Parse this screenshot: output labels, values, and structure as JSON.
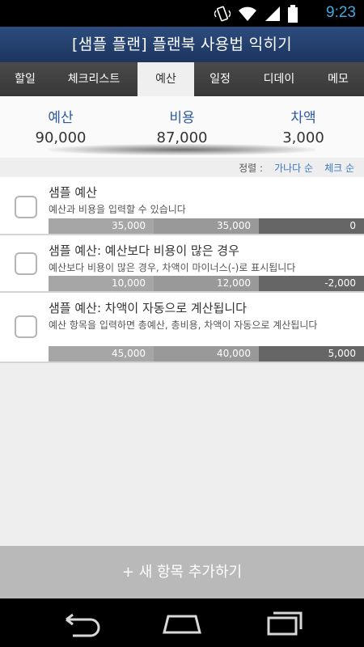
{
  "status": {
    "time": "9:23"
  },
  "title": "[샘플 플랜] 플랜북 사용법 익히기",
  "tabs": [
    {
      "label": "할일",
      "active": false
    },
    {
      "label": "체크리스트",
      "active": false
    },
    {
      "label": "예산",
      "active": true
    },
    {
      "label": "일정",
      "active": false
    },
    {
      "label": "디데이",
      "active": false
    },
    {
      "label": "메모",
      "active": false
    }
  ],
  "summary": {
    "budget_label": "예산",
    "budget_value": "90,000",
    "cost_label": "비용",
    "cost_value": "87,000",
    "diff_label": "차액",
    "diff_value": "3,000"
  },
  "sort": {
    "label": "정렬 :",
    "by_name": "가나다 순",
    "by_check": "체크 순"
  },
  "items": [
    {
      "title": "샘플 예산",
      "desc": "예산과 비용을 입력할 수 있습니다",
      "budget": "35,000",
      "cost": "35,000",
      "diff": "0"
    },
    {
      "title": "샘플 예산: 예산보다 비용이 많은 경우",
      "desc": "예산보다 비용이 많은 경우, 차액이 마이너스(-)로 표시됩니다",
      "budget": "10,000",
      "cost": "12,000",
      "diff": "-2,000"
    },
    {
      "title": "샘플 예산: 차액이 자동으로 계산됩니다",
      "desc": "예산 항목을 입력하면 총예산, 총비용, 차액이 자동으로 계산됩니다",
      "budget": "45,000",
      "cost": "40,000",
      "diff": "5,000"
    }
  ],
  "add_button": "+ 새 항목 추가하기",
  "icons": {
    "wifi": "wifi-icon",
    "signal": "signal-icon",
    "battery": "battery-icon",
    "back": "back-icon",
    "home": "home-icon",
    "recents": "recents-icon"
  },
  "colors": {
    "accent": "#2c5aa0",
    "titlebar": "#24406c",
    "time": "#3fa9e0",
    "link": "#3b79c4"
  }
}
